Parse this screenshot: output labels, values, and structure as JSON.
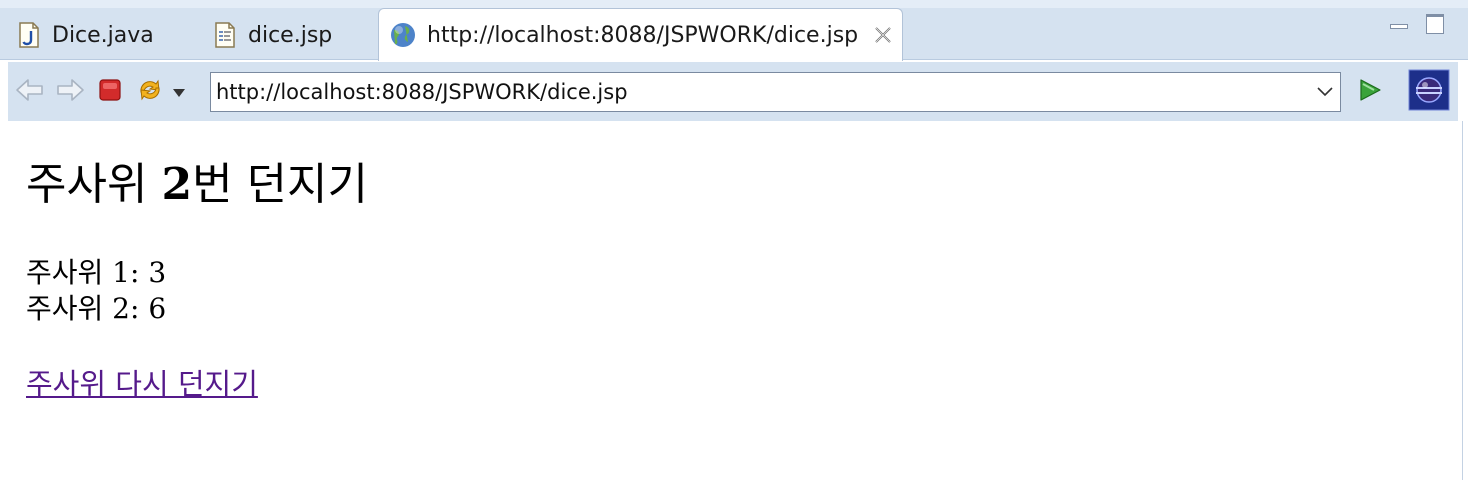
{
  "tabs": [
    {
      "label": "Dice.java",
      "icon": "java-file-icon",
      "active": false
    },
    {
      "label": "dice.jsp",
      "icon": "jsp-file-icon",
      "active": false
    },
    {
      "label": "http://localhost:8088/JSPWORK/dice.jsp",
      "icon": "globe-icon",
      "active": true
    }
  ],
  "toolbar": {
    "url": "http://localhost:8088/JSPWORK/dice.jsp",
    "buttons": [
      "back-arrow-icon",
      "forward-arrow-icon",
      "stop-icon",
      "refresh-icon",
      "menu-dropdown-icon",
      "go-icon",
      "eclipse-logo-icon"
    ]
  },
  "content": {
    "heading_prefix": "주사위 ",
    "heading_count": "2",
    "heading_suffix": "번 던지기",
    "dice": [
      {
        "label": "주사위 1: 3"
      },
      {
        "label": "주사위 2: 6"
      }
    ],
    "link_label": "주사위 다시 던지기"
  },
  "colors": {
    "chrome": "#d5e2f0",
    "link_visited": "#551a8b",
    "stop_red": "#d22b2b",
    "go_green": "#3aa33a"
  }
}
